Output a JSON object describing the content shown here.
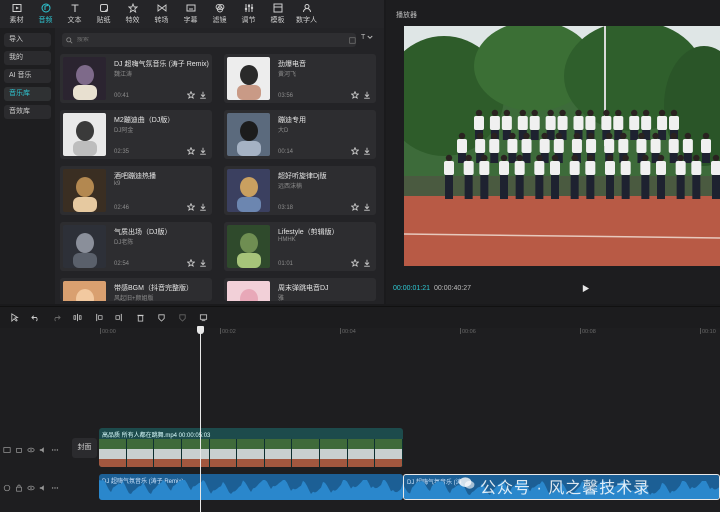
{
  "toolbar": {
    "tabs": [
      {
        "label": "素材",
        "icon": "media-icon"
      },
      {
        "label": "音频",
        "icon": "audio-icon"
      },
      {
        "label": "文本",
        "icon": "text-icon"
      },
      {
        "label": "贴纸",
        "icon": "sticker-icon"
      },
      {
        "label": "特效",
        "icon": "effects-icon"
      },
      {
        "label": "转场",
        "icon": "transition-icon"
      },
      {
        "label": "字幕",
        "icon": "caption-icon"
      },
      {
        "label": "滤镜",
        "icon": "filter-icon"
      },
      {
        "label": "调节",
        "icon": "adjust-icon"
      },
      {
        "label": "模板",
        "icon": "template-icon"
      },
      {
        "label": "数字人",
        "icon": "avatar-icon"
      }
    ],
    "active": "音频",
    "accent": "#2fc7d3"
  },
  "library_nav": {
    "items": [
      "导入",
      "我的",
      "AI 音乐",
      "音乐库",
      "音效库"
    ],
    "active": "音乐库"
  },
  "library": {
    "search_placeholder": "搜索",
    "filter_label": "T",
    "songs": [
      {
        "title": "DJ 超嗨气氛音乐 (涛子 Remix)",
        "artist": "魏江涛",
        "duration": "00:41"
      },
      {
        "title": "劲爆电音",
        "artist": "黄河飞",
        "duration": "03:56"
      },
      {
        "title": "M2蹦迪曲（DJ版）",
        "artist": "DJ阿金",
        "duration": "02:35"
      },
      {
        "title": "蹦迪专用",
        "artist": "大D",
        "duration": "00:14"
      },
      {
        "title": "酒吧蹦迪热播",
        "artist": "k9",
        "duration": "02:46"
      },
      {
        "title": "超好听旋律Dj版",
        "artist": "远西沫楠",
        "duration": "03:18"
      },
      {
        "title": "气质出场（DJ版）",
        "artist": "DJ老陈",
        "duration": "02:54"
      },
      {
        "title": "Lifestyle（剪辑版）",
        "artist": "HMHK",
        "duration": "01:01"
      },
      {
        "title": "带感BGM（抖音完整版）",
        "artist": "风起旧+颜姐版",
        "duration": ""
      },
      {
        "title": "周末弹跳电音DJ",
        "artist": "雅",
        "duration": ""
      }
    ]
  },
  "player": {
    "title": "播放器",
    "current_time": "00:00:01:21",
    "total_time": "00:00:40:27"
  },
  "timeline": {
    "ruler_labels": [
      "00:00",
      "00:02",
      "00:04",
      "00:06",
      "00:08",
      "00:10"
    ],
    "cover_label": "封面",
    "video_clip_label": "高品质 所有人都在跳舞.mp4  00:00:05:03",
    "audio_clip_label": "DJ 超嗨气氛音乐 (涛子 Remix)",
    "audio_clip_label_2": "DJ 超嗨气氛音乐 (涛",
    "audio_color": "#1c6aa6"
  },
  "watermark": {
    "text": "公众号 · 风之馨技术录"
  }
}
